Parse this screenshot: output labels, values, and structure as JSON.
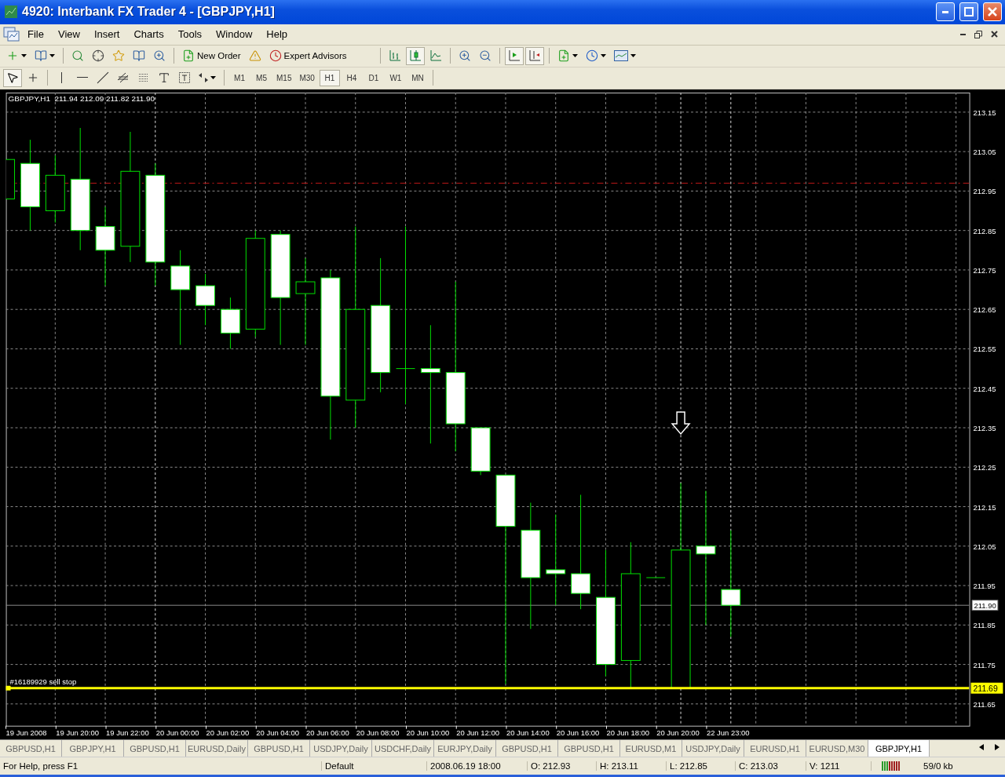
{
  "window": {
    "title": "4920: Interbank FX Trader 4 - [GBPJPY,H1]"
  },
  "menu": [
    {
      "label": "File"
    },
    {
      "label": "View"
    },
    {
      "label": "Insert"
    },
    {
      "label": "Charts"
    },
    {
      "label": "Tools"
    },
    {
      "label": "Window"
    },
    {
      "label": "Help"
    }
  ],
  "toolbar": {
    "new_order": "New Order",
    "expert_advisors": "Expert Advisors"
  },
  "chart_types": [
    {
      "kind": "bars",
      "selected": false
    },
    {
      "kind": "candles",
      "selected": true
    },
    {
      "kind": "line",
      "selected": false
    }
  ],
  "timeframes": [
    {
      "label": "M1",
      "selected": false
    },
    {
      "label": "M5",
      "selected": false
    },
    {
      "label": "M15",
      "selected": false
    },
    {
      "label": "M30",
      "selected": false
    },
    {
      "label": "H1",
      "selected": true
    },
    {
      "label": "H4",
      "selected": false
    },
    {
      "label": "D1",
      "selected": false
    },
    {
      "label": "W1",
      "selected": false
    },
    {
      "label": "MN",
      "selected": false
    }
  ],
  "chart": {
    "header": "GBPJPY,H1  211.94 212.09 211.82 211.90",
    "order_label": "#16189929 sell stop",
    "order_price_tag": "211.69",
    "current_price_tag": "211.90",
    "time_labels": [
      "19 Jun 2008",
      "19 Jun 20:00",
      "19 Jun 22:00",
      "20 Jun 00:00",
      "20 Jun 02:00",
      "20 Jun 04:00",
      "20 Jun 06:00",
      "20 Jun 08:00",
      "20 Jun 10:00",
      "20 Jun 12:00",
      "20 Jun 14:00",
      "20 Jun 16:00",
      "20 Jun 18:00",
      "20 Jun 20:00",
      "22 Jun 23:00"
    ],
    "price_labels": [
      "213.15",
      "213.05",
      "212.95",
      "212.85",
      "212.75",
      "212.65",
      "212.55",
      "212.45",
      "212.35",
      "212.25",
      "212.15",
      "212.05",
      "211.95",
      "211.85",
      "211.75",
      "211.65"
    ]
  },
  "tabs": [
    {
      "label": "GBPUSD,H1",
      "selected": false
    },
    {
      "label": "GBPJPY,H1",
      "selected": false
    },
    {
      "label": "GBPUSD,H1",
      "selected": false
    },
    {
      "label": "EURUSD,Daily",
      "selected": false
    },
    {
      "label": "GBPUSD,H1",
      "selected": false
    },
    {
      "label": "USDJPY,Daily",
      "selected": false
    },
    {
      "label": "USDCHF,Daily",
      "selected": false
    },
    {
      "label": "EURJPY,Daily",
      "selected": false
    },
    {
      "label": "GBPUSD,H1",
      "selected": false
    },
    {
      "label": "GBPUSD,H1",
      "selected": false
    },
    {
      "label": "EURUSD,M1",
      "selected": false
    },
    {
      "label": "USDJPY,Daily",
      "selected": false
    },
    {
      "label": "EURUSD,H1",
      "selected": false
    },
    {
      "label": "EURUSD,M30",
      "selected": false
    },
    {
      "label": "GBPJPY,H1",
      "selected": true
    }
  ],
  "status_bar": {
    "help": "For Help, press F1",
    "profile": "Default",
    "time": "2008.06.19 18:00",
    "open": "O: 212.93",
    "high": "H: 213.11",
    "low": "L: 212.85",
    "close": "C: 213.03",
    "volume": "V: 1211",
    "traffic": "59/0 kb"
  }
}
